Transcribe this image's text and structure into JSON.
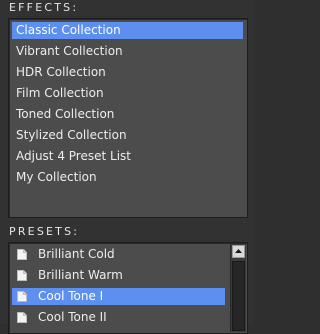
{
  "effects": {
    "label": "EFFECTS:",
    "items": [
      {
        "label": "Classic Collection",
        "selected": true
      },
      {
        "label": "Vibrant Collection",
        "selected": false
      },
      {
        "label": "HDR Collection",
        "selected": false
      },
      {
        "label": "Film Collection",
        "selected": false
      },
      {
        "label": "Toned Collection",
        "selected": false
      },
      {
        "label": "Stylized Collection",
        "selected": false
      },
      {
        "label": "Adjust 4 Preset List",
        "selected": false
      },
      {
        "label": "My Collection",
        "selected": false
      }
    ]
  },
  "presets": {
    "label": "PRESETS:",
    "items": [
      {
        "label": "Brilliant Cold",
        "icon": "preset-file-icon",
        "selected": false
      },
      {
        "label": "Brilliant Warm",
        "icon": "preset-file-icon",
        "selected": false
      },
      {
        "label": "Cool Tone I",
        "icon": "preset-file-icon",
        "selected": true
      },
      {
        "label": "Cool Tone II",
        "icon": "preset-file-icon",
        "selected": false
      }
    ],
    "scrollbar": {
      "up_icon": "arrow-up-icon"
    }
  },
  "colors": {
    "selection": "#5d8ff0",
    "list_background": "#4c4c4c",
    "panel_background": "#323232",
    "text": "#ededed"
  }
}
